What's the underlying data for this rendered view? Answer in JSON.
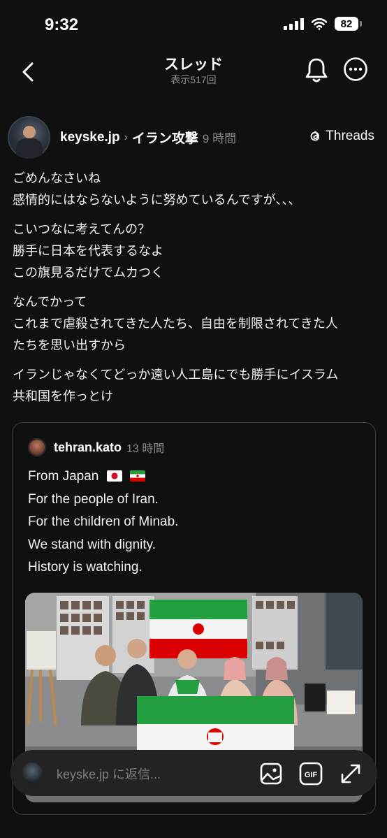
{
  "status_bar": {
    "time": "9:32",
    "battery": "82"
  },
  "nav": {
    "title": "スレッド",
    "subtitle": "表示517回"
  },
  "post": {
    "username": "keyske.jp",
    "topic": "イラン攻撃",
    "time": "9 時間",
    "threads_label": "Threads",
    "paragraphs": [
      [
        "ごめんなさいね",
        "感情的にはならないように努めているんですが、、、"
      ],
      [
        "こいつなに考えてんの？",
        "勝手に日本を代表するなよ",
        "この旗見るだけでムカつく"
      ],
      [
        "なんでかって",
        "これまで虐殺されてきた人たち、自由を制限されてきた人",
        "たちを思い出すから"
      ],
      [
        "イランじゃなくてどっか遠い人工島にでも勝手にイスラム",
        "共和国を作っとけ"
      ]
    ]
  },
  "quoted_post": {
    "username": "tehran.kato",
    "time": "13 時間",
    "lines": [
      "From Japan",
      "For the people of Iran.",
      "For the children of Minab.",
      "We stand with dignity.",
      "History is watching."
    ],
    "flags": [
      "japan-flag",
      "iran-flag"
    ]
  },
  "reply": {
    "placeholder": "keyske.jp に返信..."
  },
  "icons": [
    "back-icon",
    "bell-icon",
    "more-icon",
    "threads-icon",
    "image-icon",
    "gif-icon",
    "expand-icon"
  ],
  "colors": {
    "background": "#101010",
    "text": "#f3f3f3",
    "muted": "#8a8a8a",
    "card_border": "#3a3a3a",
    "reply_bar": "#232323"
  }
}
